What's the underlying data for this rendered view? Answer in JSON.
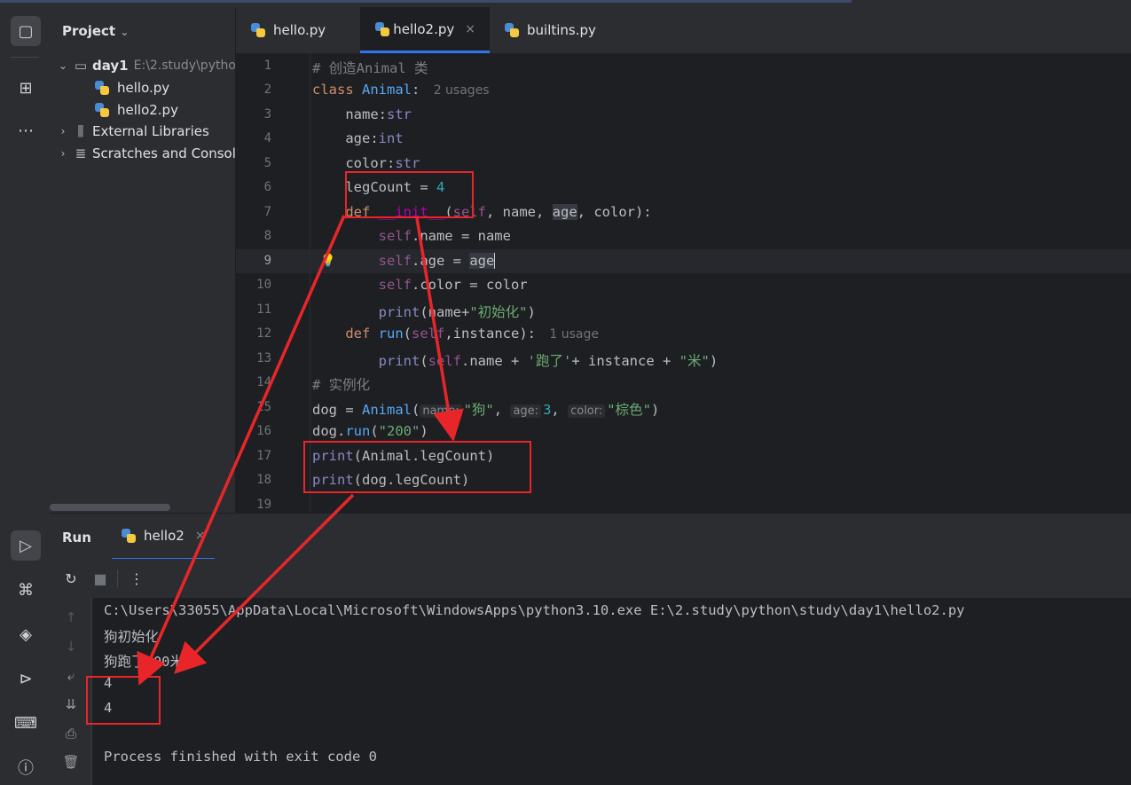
{
  "project": {
    "title": "Project",
    "tree": [
      {
        "label": "day1",
        "detail": "E:\\2.study\\pytho"
      },
      {
        "label": "hello.py"
      },
      {
        "label": "hello2.py"
      },
      {
        "label": "External Libraries"
      },
      {
        "label": "Scratches and Consol"
      }
    ]
  },
  "tabs": [
    {
      "label": "hello.py"
    },
    {
      "label": "hello2.py"
    },
    {
      "label": "builtins.py"
    }
  ],
  "editor": {
    "line_numbers": [
      "1",
      "2",
      "3",
      "4",
      "5",
      "6",
      "7",
      "8",
      "9",
      "10",
      "11",
      "12",
      "13",
      "14",
      "15",
      "16",
      "17",
      "18",
      "19"
    ],
    "current_line": "9",
    "lines": {
      "l1": "# 创造Animal 类",
      "l2_kw": "class",
      "l2_cls": "Animal",
      "l2_colon": ":",
      "l2_usage": "2 usages",
      "l3_a": "name:",
      "l3_b": "str",
      "l4_a": "age:",
      "l4_b": "int",
      "l5_a": "color:",
      "l5_b": "str",
      "l6_a": "legCount = ",
      "l6_b": "4",
      "l7_kw": "def",
      "l7_fn": "__init__",
      "l7_a": "(",
      "l7_self": "self",
      "l7_b": ", name, ",
      "l7_ref": "age",
      "l7_c": ", color):",
      "l8_self": "self",
      "l8_rest": ".name = name",
      "l9_self": "self",
      "l9_rest": ".age = ",
      "l9_ref": "age",
      "l10_self": "self",
      "l10_rest": ".color = color",
      "l11_fn": "print",
      "l11_a": "(name+",
      "l11_str": "\"初始化\"",
      "l11_b": ")",
      "l12_kw": "def",
      "l12_fn": "run",
      "l12_a": "(",
      "l12_self": "self",
      "l12_b": ",instance):",
      "l12_usage": "1 usage",
      "l13_fn": "print",
      "l13_a": "(",
      "l13_self": "self",
      "l13_b": ".name + ",
      "l13_str1": "'跑了'",
      "l13_c": "+ instance + ",
      "l13_str2": "\"米\"",
      "l13_d": ")",
      "l14": "# 实例化",
      "l15_a": "dog = ",
      "l15_cls": "Animal",
      "l15_b": "(",
      "l15_h1": "name:",
      "l15_s1": "\"狗\"",
      "l15_c1": ",",
      "l15_h2": "age:",
      "l15_n": "3",
      "l15_c2": ",",
      "l15_h3": "color:",
      "l15_s3": "\"棕色\"",
      "l15_d": ")",
      "l16_a": "dog.",
      "l16_fn": "run",
      "l16_b": "(",
      "l16_str": "\"200\"",
      "l16_c": ")",
      "l17_fn": "print",
      "l17_a": "(Animal.legCount)",
      "l18_fn": "print",
      "l18_a": "(dog.legCount)"
    }
  },
  "run": {
    "label": "Run",
    "tab": "hello2",
    "console": [
      "C:\\Users\\33055\\AppData\\Local\\Microsoft\\WindowsApps\\python3.10.exe E:\\2.study\\python\\study\\day1\\hello2.py",
      "狗初始化",
      "狗跑了200米",
      "4",
      "4",
      "",
      "Process finished with exit code 0"
    ]
  },
  "colors": {
    "background": "#1e1f22",
    "panel": "#2b2d30",
    "accent": "#3574f0",
    "annotation": "#e8262a",
    "keyword": "#cf8e6d",
    "string": "#6aab73",
    "number": "#2aacb8"
  }
}
